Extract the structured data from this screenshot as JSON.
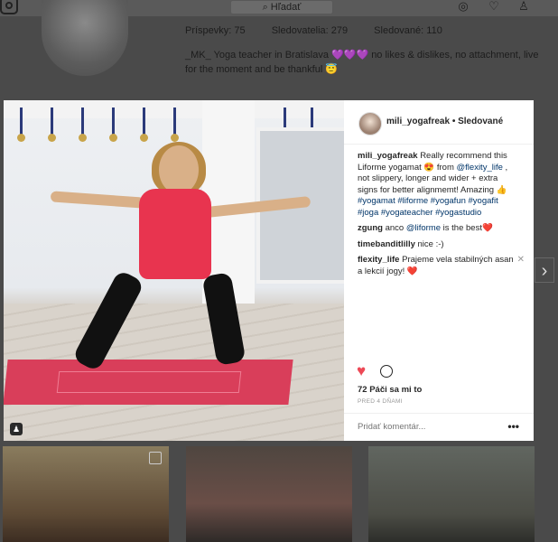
{
  "header": {
    "search_placeholder": "Hľadať"
  },
  "profile": {
    "stats": {
      "posts": "Príspevky: 75",
      "followers": "Sledovatelia: 279",
      "following": "Sledované: 110"
    },
    "bio": "_MK_ Yoga teacher in Bratislava 💜💜💜 no likes & dislikes, no attachment, live for the moment and be thankful 😇"
  },
  "post": {
    "username": "mili_yogafreak",
    "follow_status": "• Sledované",
    "caption": {
      "user": "mili_yogafreak",
      "text_before": "Really recommend this Liforme yogamat 😍 from ",
      "mention": "@flexity_life",
      "text_after": " , not slippery, longer and wider + extra signs for better alignmemt! Amazing 👍 ",
      "hashtags": "#yogamat #liforme #yogafun #yogafit #joga #yogateacher #yogastudio"
    },
    "comments": [
      {
        "user": "zgung",
        "before": "anco ",
        "mention": "@liforme",
        "after": " is the best❤️"
      },
      {
        "user": "timebanditlilly",
        "before": "nice :-)",
        "mention": "",
        "after": ""
      },
      {
        "user": "flexity_life",
        "before": "Prajeme vela stabilných asan a lekcií jogy! ❤️",
        "mention": "",
        "after": ""
      }
    ],
    "likes": "72 Páči sa mi to",
    "date": "PRED 4 DŇAMI",
    "composer_placeholder": "Pridať komentár...",
    "more_label": "•••"
  },
  "icons": {
    "logo": "instagram-logo-icon",
    "search": "search-icon",
    "explore": "compass-icon",
    "activity": "heart-icon",
    "profile": "person-icon",
    "like": "heart-filled-icon",
    "comment": "comment-bubble-icon",
    "next": "chevron-right-icon",
    "close": "close-icon"
  },
  "colors": {
    "like": "#ed4956",
    "link": "#003569",
    "mat": "#d93e5a",
    "shirt": "#e8344f"
  }
}
